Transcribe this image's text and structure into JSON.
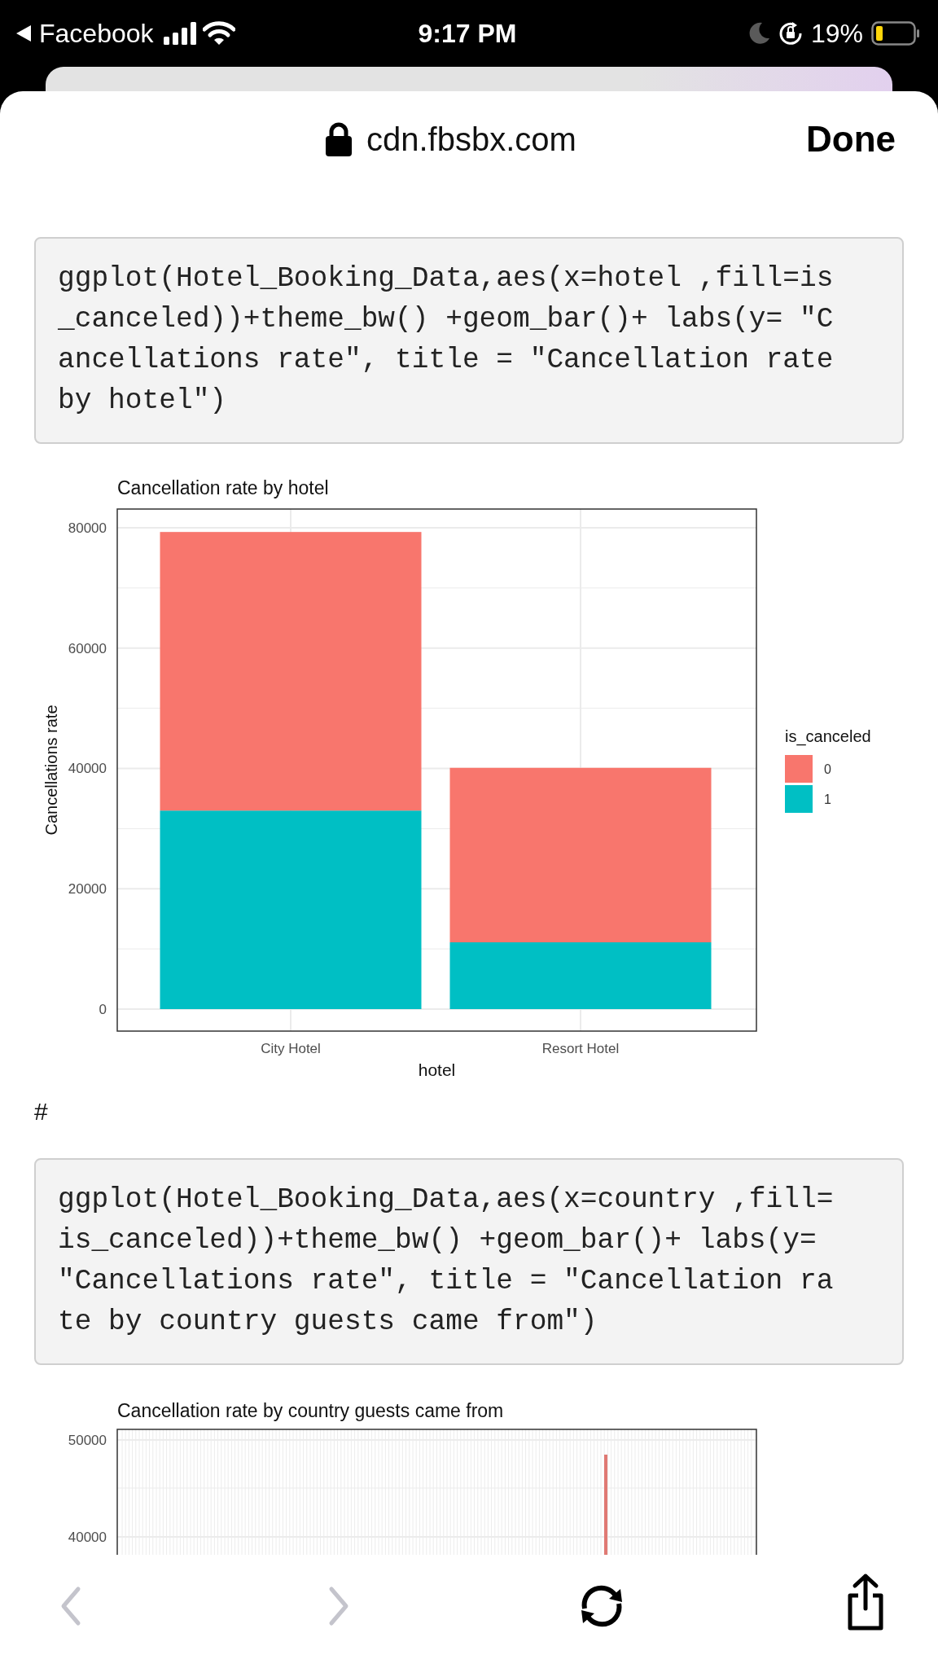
{
  "status_bar": {
    "back_app": "Facebook",
    "time": "9:17 PM",
    "battery": "19%"
  },
  "address_bar": {
    "url": "cdn.fbsbx.com",
    "done": "Done"
  },
  "content": [
    {
      "kind": "code",
      "lines": [
        "ggplot(Hotel_Booking_Data,aes(x=hotel ,fill=is",
        "_canceled))+theme_bw() +geom_bar()+ labs(y= \"C",
        "ancellations rate\", title = \"Cancellation rate",
        "by hotel\")"
      ]
    },
    {
      "kind": "chart",
      "chart_data": {
        "type": "bar",
        "stacked": true,
        "title": "Cancellation rate by hotel",
        "xlabel": "hotel",
        "ylabel": "Cancellations rate",
        "categories": [
          "City Hotel",
          "Resort Hotel"
        ],
        "legend": {
          "title": "is_canceled"
        },
        "grid": true,
        "ylim": [
          -3655,
          83113
        ],
        "yticks": [
          0,
          20000,
          40000,
          60000,
          80000
        ],
        "series": [
          {
            "name": "0",
            "color": "#f8766d",
            "values": [
              46300,
              29000
            ]
          },
          {
            "name": "1",
            "color": "#00bfc4",
            "values": [
              33000,
              11100
            ]
          }
        ]
      }
    },
    {
      "kind": "text",
      "text": "#"
    },
    {
      "kind": "code",
      "lines": [
        "ggplot(Hotel_Booking_Data,aes(x=country ,fill=",
        "is_canceled))+theme_bw() +geom_bar()+ labs(y=",
        "\"Cancellations rate\", title = \"Cancellation ra",
        "te by country guests came from\")"
      ]
    },
    {
      "kind": "chart_picture",
      "title": "Cancellation rate by country guests came from",
      "y_tick_labels": [
        "50000",
        "40000"
      ]
    }
  ],
  "toolbar": [
    {
      "kind": "back",
      "disabled": true
    },
    {
      "kind": "forward",
      "disabled": true
    },
    {
      "kind": "reload",
      "disabled": false
    },
    {
      "kind": "share",
      "disabled": false
    }
  ]
}
